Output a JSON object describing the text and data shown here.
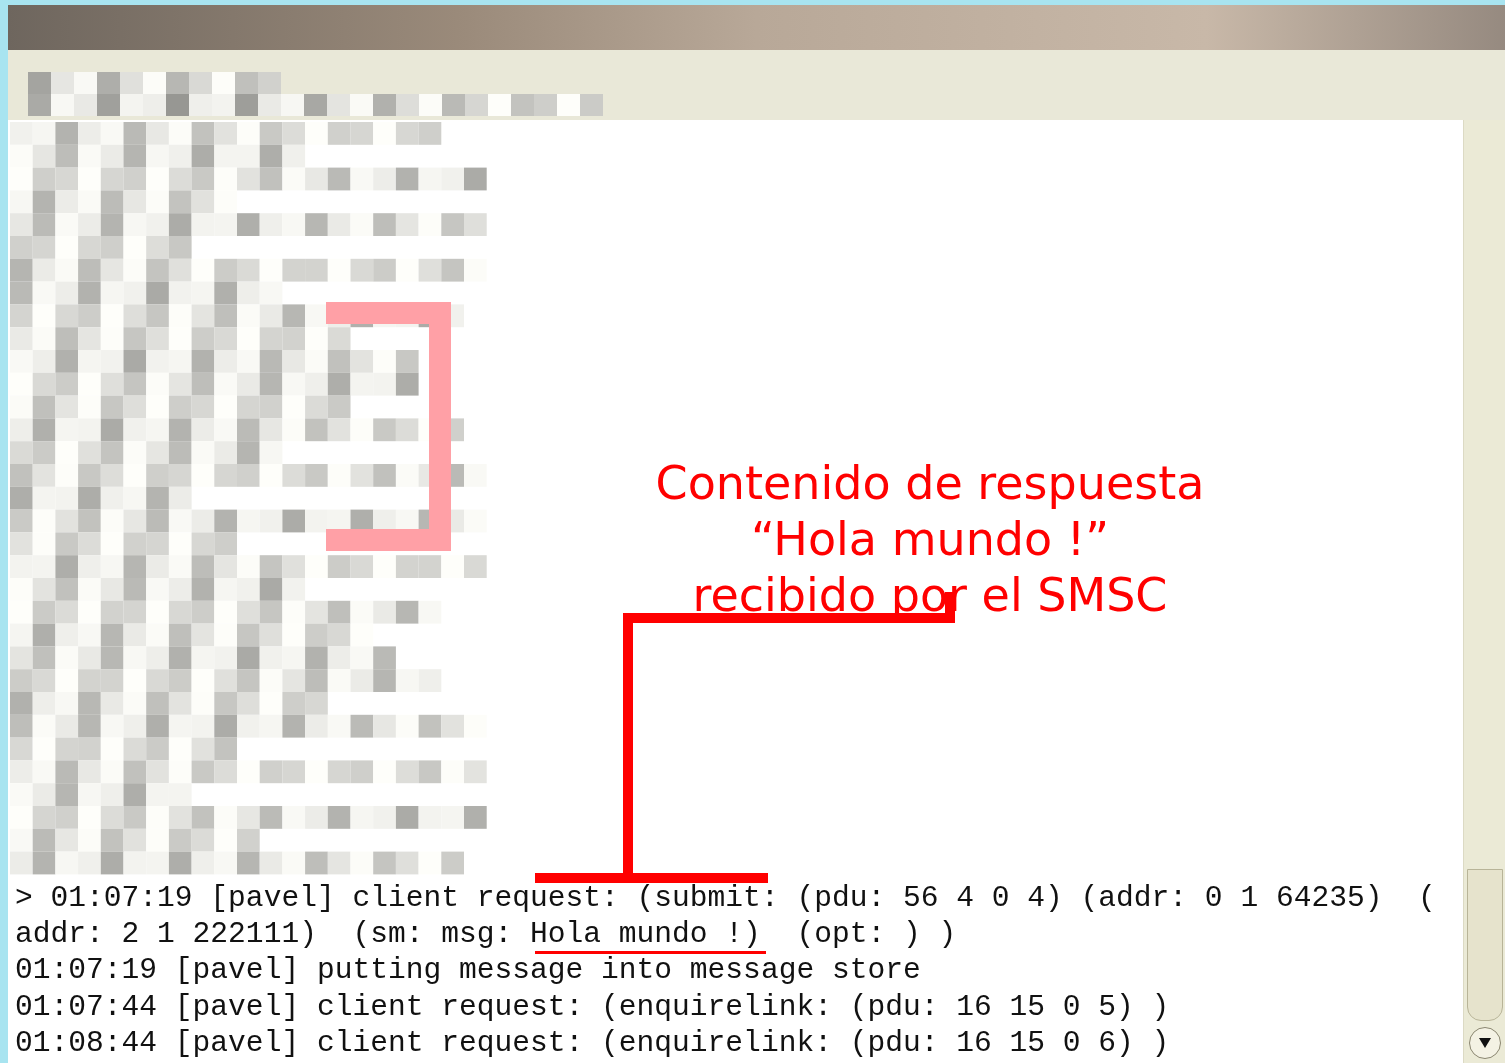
{
  "annotation": {
    "lines": [
      "Contenido de respuesta",
      "“Hola mundo !”",
      "recibido por el SMSC"
    ]
  },
  "log": {
    "lines": [
      "> 01:07:19 [pavel] client request: (submit: (pdu: 56 4 0 4) (addr: 0 1 64235)  (",
      "addr: 2 1 222111)  (sm: msg: Hola mundo !)  (opt: ) )",
      "01:07:19 [pavel] putting message into message store",
      "01:07:44 [pavel] client request: (enquirelink: (pdu: 16 15 0 5) )",
      "01:08:44 [pavel] client request: (enquirelink: (pdu: 16 15 0 6) )"
    ]
  }
}
